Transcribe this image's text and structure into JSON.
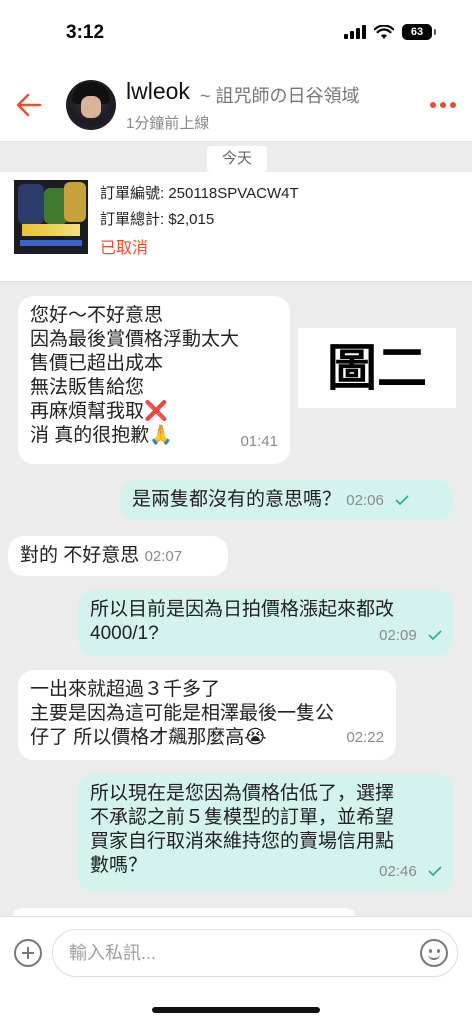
{
  "status_bar": {
    "time": "3:12",
    "battery": "63"
  },
  "header": {
    "shop_name": "lwleok",
    "shop_subtitle": "~ 詛咒師の日谷領域",
    "online_status": "1分鐘前上線",
    "back_icon": "back-arrow-icon",
    "more_icon": "more-dots-icon"
  },
  "date_divider": "今天",
  "order": {
    "number_label": "訂單編號: 250118SPVACW4T",
    "total_label": "訂單總計: $2,015",
    "status": "已取消"
  },
  "overlay_label": "圖二",
  "messages": [
    {
      "direction": "in",
      "text": "您好～不好意思\n因為最後賞價格浮動太大\n售價已超出成本\n無法販售給您\n再麻煩幫我取❌\n消 真的很抱歉🙏",
      "time": "01:41"
    },
    {
      "direction": "out",
      "text": "是兩隻都沒有的意思嗎？",
      "time": "02:06"
    },
    {
      "direction": "in",
      "text": "對的 不好意思",
      "time": "02:07"
    },
    {
      "direction": "out",
      "text": "所以目前是因為日拍價格漲起來都改\n4000/1?",
      "time": "02:09"
    },
    {
      "direction": "in",
      "text": "一出來就超過３千多了\n主要是因為這可能是相澤最後一隻公\n仔了 所以價格才飆那麼高😭",
      "time": "02:22"
    },
    {
      "direction": "out",
      "text": "所以現在是您因為價格估低了，選擇\n不承認之前５隻模型的訂單，並希望\n買家自行取消來維持您的賣場信用點\n數嗎？",
      "time": "02:46"
    }
  ],
  "input": {
    "placeholder": "輸入私訊..."
  },
  "colors": {
    "accent": "#ee4d2d",
    "outgoing_bubble": "#d4f3ee",
    "incoming_bubble": "#ffffff",
    "background": "#ececec",
    "read_tick": "#26aa99"
  }
}
